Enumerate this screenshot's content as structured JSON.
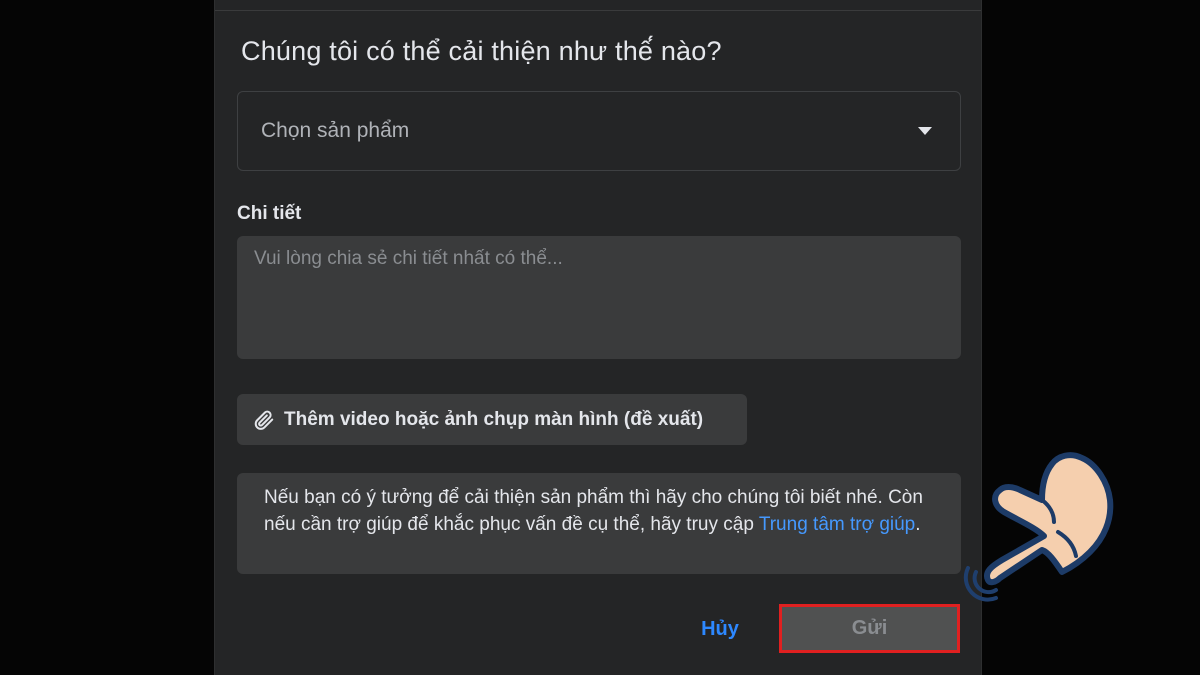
{
  "dialog": {
    "title": "Chúng tôi có thể cải thiện như thế́ nào?",
    "product_select": {
      "value": "Chọn sản phẩm",
      "icon": "caret-down-icon"
    },
    "details": {
      "label": "Chi tiết",
      "placeholder": "Vui lòng chia sẻ chi tiết nhất có thể..."
    },
    "attach_button": {
      "label": "Thêm video hoặc ảnh chụp màn hình (đề xuất)",
      "icon": "paperclip-icon"
    },
    "info": {
      "text": "Nếu bạn có ý tưởng để cải thiện sản phẩm thì hãy cho chúng tôi biết nhé. Còn nếu cần trợ giúp để khắc phục vấn đề cụ thể, hãy truy cập ",
      "link_text": "Trung tâm trợ giúp",
      "suffix": "."
    },
    "actions": {
      "cancel_label": "Hủy",
      "submit_label": "Gửi"
    }
  },
  "overlay": {
    "pointer": "pointing-hand-icon",
    "highlight_color": "#e02020"
  },
  "colors": {
    "background": "#000000",
    "dialog": "#242526",
    "field": "#3a3b3c",
    "link": "#2d88ff",
    "text": "#e4e6eb"
  }
}
